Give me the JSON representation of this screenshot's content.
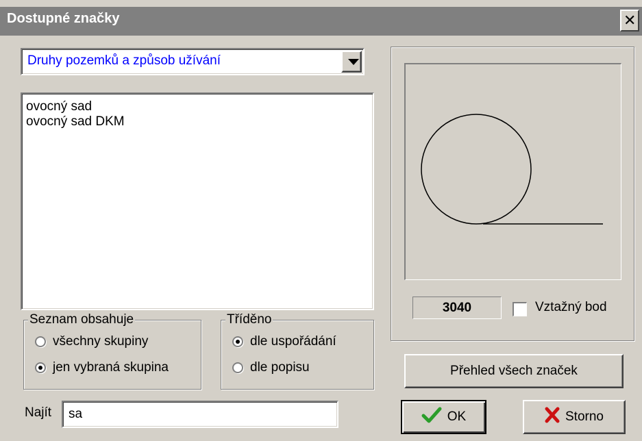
{
  "window": {
    "title": "Dostupné značky",
    "close_label": "×"
  },
  "category_combo": {
    "value": "Druhy pozemků a způsob užívání"
  },
  "symbol_list": {
    "items": [
      "ovocný sad",
      "ovocný sad DKM"
    ]
  },
  "list_contains_group": {
    "legend": "Seznam obsahuje",
    "options": [
      {
        "label": "všechny skupiny",
        "selected": false
      },
      {
        "label": "jen vybraná skupina",
        "selected": true
      }
    ]
  },
  "sorted_group": {
    "legend": "Tříděno",
    "options": [
      {
        "label": "dle uspořádání",
        "selected": true
      },
      {
        "label": "dle popisu",
        "selected": false
      }
    ]
  },
  "find": {
    "label": "Najít",
    "value": "sa"
  },
  "preview": {
    "code": "3040",
    "reference_point_label": "Vztažný bod",
    "reference_point_checked": false
  },
  "buttons": {
    "overview": "Přehled všech značek",
    "ok": "OK",
    "cancel": "Storno"
  },
  "icons": {
    "ok": "check-icon",
    "cancel": "x-icon",
    "combo": "dropdown-arrow-icon"
  },
  "colors": {
    "title_bar": "#808080",
    "combo_text": "#0000ff",
    "ok_icon": "#2a9d2a",
    "cancel_icon": "#cc1111"
  }
}
